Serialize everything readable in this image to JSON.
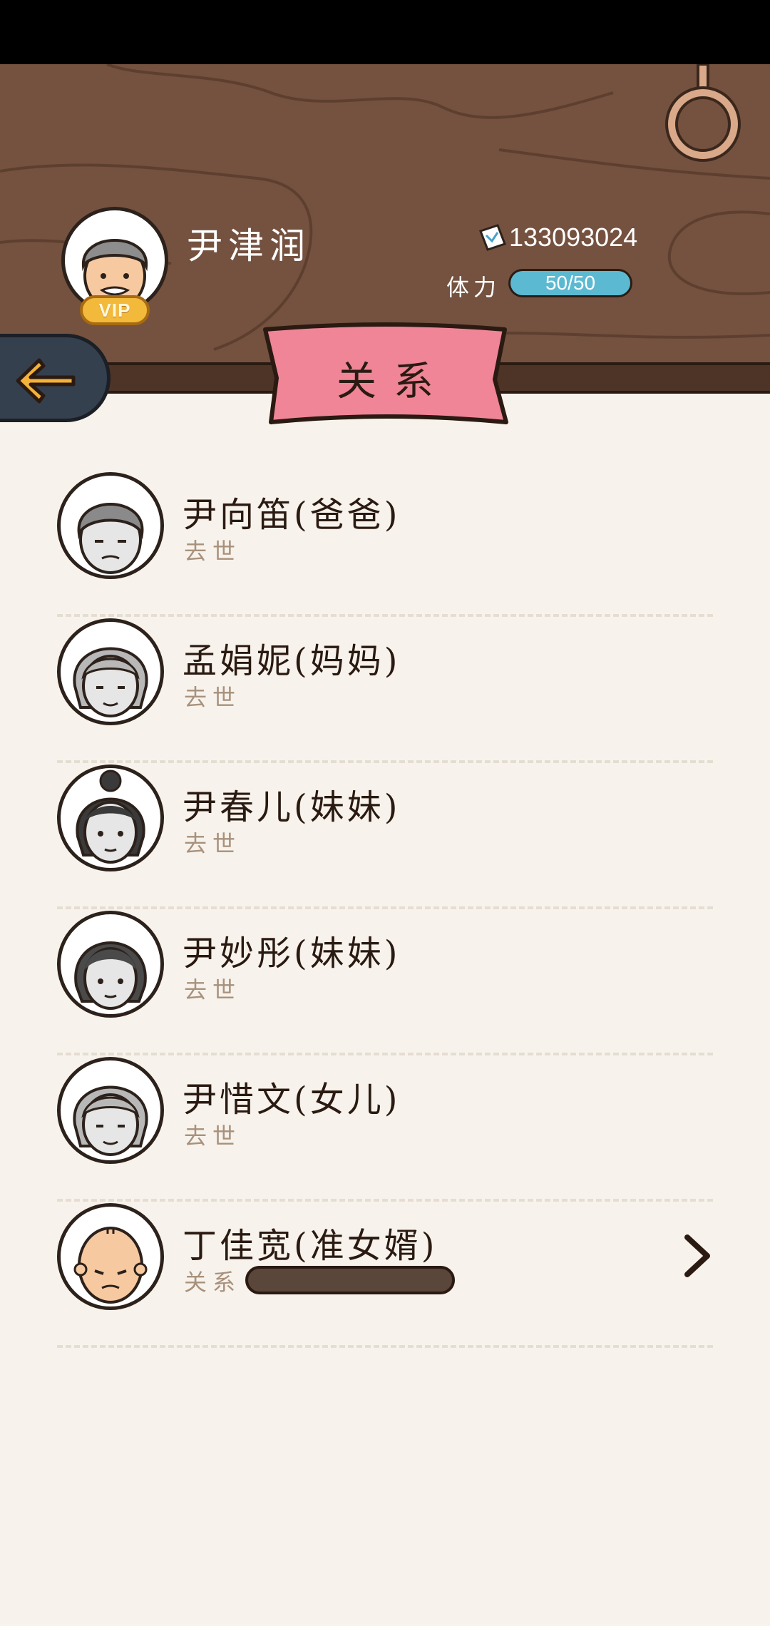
{
  "header": {
    "player_name": "尹津润",
    "vip_label": "VIP",
    "coins": "133093024",
    "stamina_label": "体力",
    "stamina_value": "50/50",
    "stamina_fraction": 1.0
  },
  "page_title": "关系",
  "relations": [
    {
      "name": "尹向笛(爸爸)",
      "status": "去世",
      "avatar": "old-man-icon"
    },
    {
      "name": "孟娟妮(妈妈)",
      "status": "去世",
      "avatar": "old-woman-icon"
    },
    {
      "name": "尹春儿(妹妹)",
      "status": "去世",
      "avatar": "woman-bun-icon"
    },
    {
      "name": "尹妙彤(妹妹)",
      "status": "去世",
      "avatar": "woman-icon"
    },
    {
      "name": "尹惜文(女儿)",
      "status": "去世",
      "avatar": "old-woman-icon"
    },
    {
      "name": "丁佳宽(准女婿)",
      "status": "关系",
      "avatar": "bald-man-icon",
      "relationship_level": 0
    }
  ],
  "colors": {
    "header_wood": "#74523f",
    "banner_pink": "#ef8596",
    "background": "#f7f3ec",
    "stamina_blue": "#5bbad2"
  }
}
